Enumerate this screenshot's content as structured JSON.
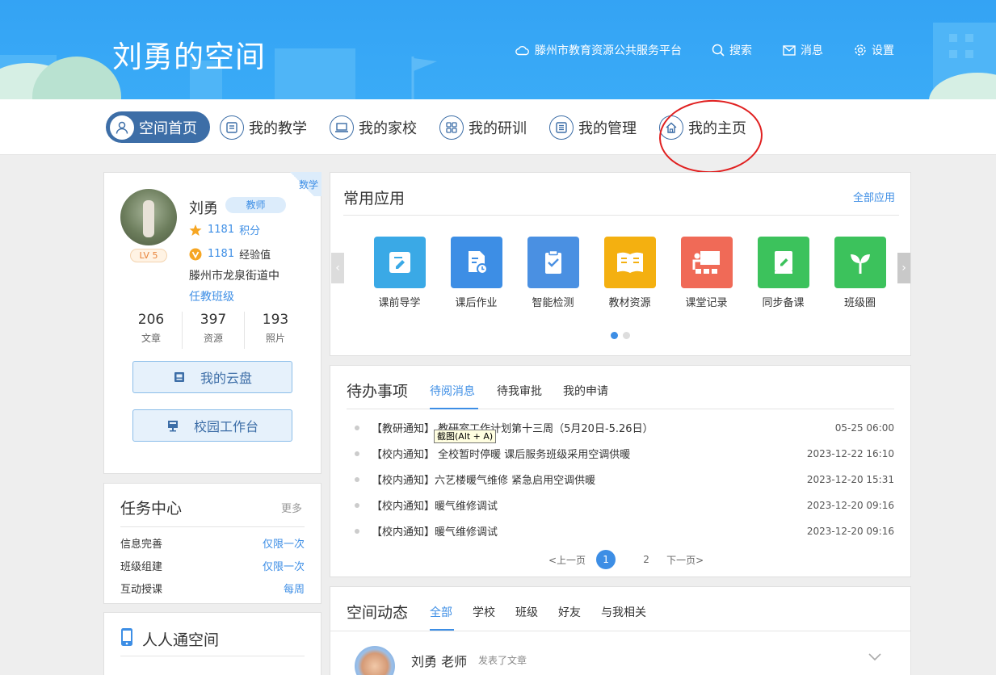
{
  "header": {
    "title": "刘勇的空间",
    "nav": [
      {
        "label": "滕州市教育资源公共服务平台",
        "icon": "cloud-icon"
      },
      {
        "label": "搜索",
        "icon": "search-icon"
      },
      {
        "label": "消息",
        "icon": "mail-icon"
      },
      {
        "label": "设置",
        "icon": "gear-icon"
      }
    ]
  },
  "tabs": [
    {
      "label": "空间首页",
      "icon": "user-icon",
      "active": true
    },
    {
      "label": "我的教学",
      "icon": "book-icon"
    },
    {
      "label": "我的家校",
      "icon": "laptop-icon"
    },
    {
      "label": "我的研训",
      "icon": "grid-icon"
    },
    {
      "label": "我的管理",
      "icon": "list-icon"
    },
    {
      "label": "我的主页",
      "icon": "home-icon"
    }
  ],
  "profile": {
    "corner_tag": "数学",
    "name": "刘勇",
    "role": "教师",
    "level": "LV 5",
    "points_value": "1181",
    "points_label": "积分",
    "exp_value": "1181",
    "exp_label": "经验值",
    "school": "滕州市龙泉街道中",
    "duty_link": "任教班级",
    "counts": [
      {
        "num": "206",
        "label": "文章"
      },
      {
        "num": "397",
        "label": "资源"
      },
      {
        "num": "193",
        "label": "照片"
      }
    ],
    "cloud_btn": "我的云盘",
    "workbench_btn": "校园工作台"
  },
  "tasks": {
    "title": "任务中心",
    "more": "更多",
    "items": [
      {
        "label": "信息完善",
        "freq": "仅限一次"
      },
      {
        "label": "班级组建",
        "freq": "仅限一次"
      },
      {
        "label": "互动授课",
        "freq": "每周"
      }
    ]
  },
  "mobile": {
    "title": "人人通空间"
  },
  "apps": {
    "title": "常用应用",
    "all": "全部应用",
    "prev": "‹",
    "next": "›",
    "items": [
      {
        "label": "课前导学",
        "color": "#3aa9e6"
      },
      {
        "label": "课后作业",
        "color": "#3d8ee5"
      },
      {
        "label": "智能检测",
        "color": "#4a90e2"
      },
      {
        "label": "教材资源",
        "color": "#f4b010"
      },
      {
        "label": "课堂记录",
        "color": "#f06a57"
      },
      {
        "label": "同步备课",
        "color": "#3cc25c"
      },
      {
        "label": "班级圈",
        "color": "#3cc25c"
      }
    ]
  },
  "todo": {
    "title": "待办事项",
    "tabs": [
      "待阅消息",
      "待我审批",
      "我的申请"
    ],
    "items": [
      {
        "text": "【教研通知】 教研室工作计划第十三周（5月20日-5.26日）",
        "date": "05-25 06:00"
      },
      {
        "text": "【校内通知】 全校暂时停暖 课后服务班级采用空调供暖",
        "date": "2023-12-22 16:10"
      },
      {
        "text": "【校内通知】六艺楼暖气维修 紧急启用空调供暖",
        "date": "2023-12-20 15:31"
      },
      {
        "text": "【校内通知】暖气维修调试",
        "date": "2023-12-20 09:16"
      },
      {
        "text": "【校内通知】暖气维修调试",
        "date": "2023-12-20 09:16"
      }
    ],
    "pager": {
      "prev": "<上一页",
      "pages": [
        "1",
        "2"
      ],
      "next": "下一页>"
    },
    "tooltip": "截图(Alt + A)"
  },
  "feed": {
    "title": "空间动态",
    "tabs": [
      "全部",
      "学校",
      "班级",
      "好友",
      "与我相关"
    ],
    "post": {
      "author": "刘勇 老师",
      "action": "发表了文章"
    }
  }
}
